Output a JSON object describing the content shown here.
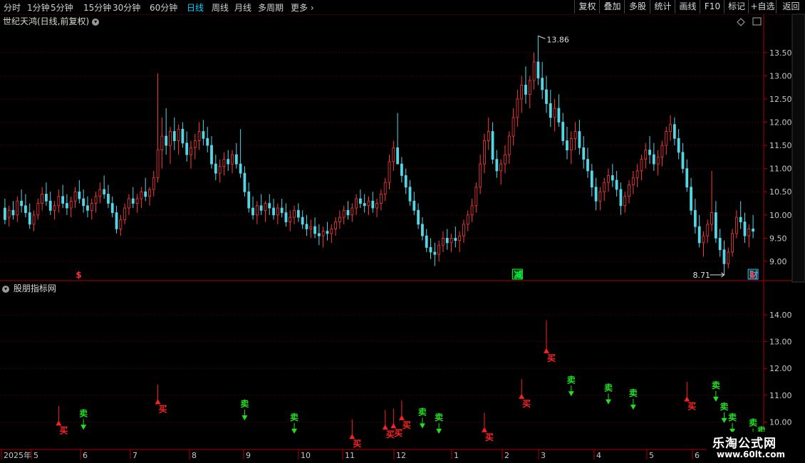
{
  "toolbar": {
    "periods": [
      "分时",
      "1分钟",
      "5分钟",
      "15分钟",
      "30分钟",
      "60分钟",
      "日线",
      "周线",
      "月线",
      "多周期",
      "更多"
    ],
    "selected": "日线",
    "right_buttons": [
      "复权",
      "叠加",
      "多股",
      "统计",
      "画线",
      "F10",
      "标记",
      "+自选",
      "返回"
    ]
  },
  "price_panel": {
    "title": "世纪天鸿(日线,前复权)",
    "high_label": "13.86",
    "low_label": "8.71",
    "y_ticks": [
      "13.50",
      "13.00",
      "12.50",
      "12.00",
      "11.50",
      "11.00",
      "10.50",
      "10.00",
      "9.50",
      "9.00"
    ],
    "markers": [
      {
        "text": "$",
        "color": "#ff3030"
      },
      {
        "text": "减",
        "color": "#00ff40"
      },
      {
        "text": "财",
        "color": "#4aa0ff"
      },
      {
        "text": "$",
        "color": "#ff3030"
      }
    ]
  },
  "indicator_panel": {
    "title": "股朋指标网",
    "y_ticks": [
      "14.00",
      "13.00",
      "12.00",
      "11.00",
      "10.00"
    ],
    "buy_label": "买",
    "sell_label": "卖"
  },
  "date_axis": {
    "labels": [
      "2025年",
      "5",
      "6",
      "7",
      "8",
      "9",
      "10",
      "11",
      "12",
      "1",
      "2",
      "3",
      "4",
      "5",
      "6"
    ]
  },
  "watermark": {
    "line1": "乐淘公式网",
    "line2": "www.60lt.com"
  },
  "colors": {
    "up": "#ff3a3a",
    "down": "#54d6e6",
    "buy": "#ff2020",
    "sell": "#20e020",
    "grid": "#6a0000"
  },
  "chart_data": {
    "type": "candlestick",
    "ylim_price": [
      8.6,
      14.05
    ],
    "ylim_indicator": [
      9.0,
      14.8
    ],
    "series_desc": "daily OHLC, approx",
    "candles": [
      [
        10.15,
        10.35,
        9.8,
        9.9
      ],
      [
        9.95,
        10.2,
        9.75,
        10.1
      ],
      [
        10.1,
        10.3,
        9.9,
        10.0
      ],
      [
        10.0,
        10.4,
        9.85,
        10.3
      ],
      [
        10.3,
        10.55,
        10.05,
        10.2
      ],
      [
        10.2,
        10.45,
        9.95,
        10.05
      ],
      [
        10.05,
        10.25,
        9.7,
        9.8
      ],
      [
        9.8,
        10.1,
        9.65,
        10.0
      ],
      [
        10.0,
        10.35,
        9.9,
        10.25
      ],
      [
        10.25,
        10.6,
        10.1,
        10.45
      ],
      [
        10.45,
        10.7,
        10.2,
        10.3
      ],
      [
        10.3,
        10.5,
        10.0,
        10.1
      ],
      [
        10.1,
        10.3,
        9.9,
        10.2
      ],
      [
        10.2,
        10.55,
        10.05,
        10.4
      ],
      [
        10.4,
        10.65,
        10.15,
        10.25
      ],
      [
        10.25,
        10.45,
        10.0,
        10.15
      ],
      [
        10.15,
        10.4,
        9.95,
        10.3
      ],
      [
        10.3,
        10.6,
        10.15,
        10.5
      ],
      [
        10.5,
        10.75,
        10.25,
        10.35
      ],
      [
        10.35,
        10.55,
        10.05,
        10.2
      ],
      [
        10.2,
        10.4,
        9.95,
        10.1
      ],
      [
        10.1,
        10.35,
        9.9,
        10.25
      ],
      [
        10.25,
        10.5,
        10.05,
        10.4
      ],
      [
        10.4,
        10.7,
        10.25,
        10.55
      ],
      [
        10.55,
        10.85,
        10.35,
        10.45
      ],
      [
        10.45,
        10.65,
        10.15,
        10.25
      ],
      [
        10.25,
        10.4,
        9.95,
        10.05
      ],
      [
        10.05,
        10.2,
        9.6,
        9.7
      ],
      [
        9.7,
        10.0,
        9.55,
        9.9
      ],
      [
        9.9,
        10.25,
        9.8,
        10.15
      ],
      [
        10.15,
        10.45,
        10.0,
        10.35
      ],
      [
        10.35,
        10.6,
        10.15,
        10.25
      ],
      [
        10.25,
        10.45,
        10.05,
        10.35
      ],
      [
        10.35,
        10.6,
        10.15,
        10.5
      ],
      [
        10.5,
        10.8,
        10.3,
        10.4
      ],
      [
        10.4,
        10.6,
        10.2,
        10.55
      ],
      [
        10.55,
        10.95,
        10.4,
        10.8
      ],
      [
        10.8,
        13.05,
        10.7,
        11.4
      ],
      [
        11.4,
        12.1,
        11.0,
        11.7
      ],
      [
        11.7,
        12.3,
        11.3,
        11.5
      ],
      [
        11.5,
        11.9,
        11.1,
        11.8
      ],
      [
        11.8,
        12.1,
        11.4,
        11.6
      ],
      [
        11.6,
        11.95,
        11.3,
        11.85
      ],
      [
        11.85,
        12.0,
        11.45,
        11.55
      ],
      [
        11.55,
        11.8,
        11.15,
        11.3
      ],
      [
        11.3,
        11.6,
        11.0,
        11.45
      ],
      [
        11.45,
        11.75,
        11.2,
        11.6
      ],
      [
        11.6,
        12.0,
        11.4,
        11.8
      ],
      [
        11.8,
        12.05,
        11.5,
        11.65
      ],
      [
        11.65,
        11.9,
        11.35,
        11.5
      ],
      [
        11.5,
        11.7,
        11.0,
        11.1
      ],
      [
        11.1,
        11.3,
        10.75,
        10.9
      ],
      [
        10.9,
        11.2,
        10.7,
        11.05
      ],
      [
        11.05,
        11.35,
        10.85,
        11.2
      ],
      [
        11.2,
        11.4,
        10.95,
        11.1
      ],
      [
        11.1,
        11.4,
        10.9,
        11.3
      ],
      [
        11.3,
        11.55,
        11.0,
        11.1
      ],
      [
        11.1,
        11.85,
        10.8,
        10.9
      ],
      [
        10.9,
        11.05,
        10.4,
        10.5
      ],
      [
        10.5,
        10.7,
        10.05,
        10.15
      ],
      [
        10.15,
        10.4,
        9.9,
        10.0
      ],
      [
        10.0,
        10.3,
        9.8,
        10.2
      ],
      [
        10.2,
        10.45,
        10.0,
        10.1
      ],
      [
        10.1,
        10.3,
        9.85,
        10.25
      ],
      [
        10.25,
        10.45,
        10.0,
        10.15
      ],
      [
        10.15,
        10.35,
        9.9,
        10.0
      ],
      [
        10.0,
        10.25,
        9.8,
        10.15
      ],
      [
        10.15,
        10.35,
        9.95,
        10.05
      ],
      [
        10.05,
        10.25,
        9.75,
        9.85
      ],
      [
        9.85,
        10.1,
        9.65,
        9.95
      ],
      [
        9.95,
        10.2,
        9.8,
        10.1
      ],
      [
        10.1,
        10.25,
        9.85,
        9.95
      ],
      [
        9.95,
        10.1,
        9.7,
        9.8
      ],
      [
        9.8,
        10.0,
        9.55,
        9.7
      ],
      [
        9.7,
        9.9,
        9.5,
        9.75
      ],
      [
        9.75,
        9.95,
        9.5,
        9.6
      ],
      [
        9.6,
        9.8,
        9.35,
        9.55
      ],
      [
        9.55,
        9.75,
        9.3,
        9.65
      ],
      [
        9.65,
        9.85,
        9.45,
        9.6
      ],
      [
        9.6,
        9.8,
        9.4,
        9.7
      ],
      [
        9.7,
        9.95,
        9.55,
        9.85
      ],
      [
        9.85,
        10.1,
        9.7,
        9.95
      ],
      [
        9.95,
        10.2,
        9.8,
        10.1
      ],
      [
        10.1,
        10.3,
        9.9,
        10.0
      ],
      [
        10.0,
        10.25,
        9.85,
        10.15
      ],
      [
        10.15,
        10.45,
        10.0,
        10.35
      ],
      [
        10.35,
        10.55,
        10.15,
        10.25
      ],
      [
        10.25,
        10.45,
        10.05,
        10.2
      ],
      [
        10.2,
        10.4,
        10.0,
        10.3
      ],
      [
        10.3,
        10.5,
        10.05,
        10.15
      ],
      [
        10.15,
        10.35,
        9.95,
        10.25
      ],
      [
        10.25,
        10.55,
        10.1,
        10.45
      ],
      [
        10.45,
        10.8,
        10.3,
        10.7
      ],
      [
        10.7,
        11.3,
        10.55,
        11.15
      ],
      [
        11.15,
        11.6,
        10.95,
        11.45
      ],
      [
        11.45,
        12.2,
        11.25,
        11.1
      ],
      [
        11.1,
        11.25,
        10.7,
        10.85
      ],
      [
        10.85,
        11.0,
        10.45,
        10.6
      ],
      [
        10.6,
        10.75,
        10.2,
        10.3
      ],
      [
        10.3,
        10.5,
        10.0,
        10.1
      ],
      [
        10.1,
        10.25,
        9.7,
        9.8
      ],
      [
        9.8,
        9.95,
        9.45,
        9.55
      ],
      [
        9.55,
        9.7,
        9.2,
        9.3
      ],
      [
        9.3,
        9.5,
        9.05,
        9.2
      ],
      [
        9.2,
        9.4,
        8.9,
        9.15
      ],
      [
        9.15,
        9.45,
        9.0,
        9.35
      ],
      [
        9.35,
        9.65,
        9.2,
        9.5
      ],
      [
        9.5,
        9.7,
        9.25,
        9.4
      ],
      [
        9.4,
        9.6,
        9.2,
        9.5
      ],
      [
        9.5,
        9.75,
        9.3,
        9.45
      ],
      [
        9.45,
        9.65,
        9.2,
        9.55
      ],
      [
        9.55,
        9.9,
        9.4,
        9.8
      ],
      [
        9.8,
        10.1,
        9.65,
        10.0
      ],
      [
        10.0,
        10.35,
        9.85,
        10.2
      ],
      [
        10.2,
        10.7,
        10.05,
        10.6
      ],
      [
        10.6,
        11.3,
        10.45,
        11.1
      ],
      [
        11.1,
        11.75,
        10.9,
        11.6
      ],
      [
        11.6,
        12.1,
        11.4,
        11.8
      ],
      [
        11.8,
        12.0,
        11.1,
        11.2
      ],
      [
        11.2,
        11.4,
        10.8,
        10.95
      ],
      [
        10.95,
        11.2,
        10.65,
        11.1
      ],
      [
        11.1,
        11.5,
        10.9,
        11.3
      ],
      [
        11.3,
        11.8,
        11.1,
        11.7
      ],
      [
        11.7,
        12.3,
        11.5,
        12.1
      ],
      [
        12.1,
        12.7,
        11.9,
        12.5
      ],
      [
        12.5,
        13.0,
        12.2,
        12.8
      ],
      [
        12.8,
        13.2,
        12.4,
        12.6
      ],
      [
        12.6,
        13.0,
        12.3,
        12.9
      ],
      [
        12.9,
        13.5,
        12.7,
        13.3
      ],
      [
        13.3,
        13.86,
        12.8,
        12.95
      ],
      [
        12.95,
        13.3,
        12.5,
        12.7
      ],
      [
        12.7,
        13.0,
        12.2,
        12.4
      ],
      [
        12.4,
        12.7,
        11.9,
        12.1
      ],
      [
        12.1,
        12.5,
        11.8,
        12.3
      ],
      [
        12.3,
        12.6,
        11.9,
        12.0
      ],
      [
        12.0,
        12.2,
        11.5,
        11.6
      ],
      [
        11.6,
        11.9,
        11.2,
        11.4
      ],
      [
        11.4,
        11.8,
        11.1,
        11.65
      ],
      [
        11.65,
        12.0,
        11.4,
        11.8
      ],
      [
        11.8,
        12.05,
        11.3,
        11.45
      ],
      [
        11.45,
        11.7,
        11.0,
        11.2
      ],
      [
        11.2,
        11.45,
        10.8,
        10.95
      ],
      [
        10.95,
        11.1,
        10.4,
        10.6
      ],
      [
        10.6,
        10.8,
        10.1,
        10.3
      ],
      [
        10.3,
        10.6,
        10.1,
        10.5
      ],
      [
        10.5,
        10.8,
        10.3,
        10.7
      ],
      [
        10.7,
        11.0,
        10.5,
        10.85
      ],
      [
        10.85,
        11.1,
        10.6,
        10.75
      ],
      [
        10.75,
        10.95,
        10.4,
        10.55
      ],
      [
        10.55,
        10.7,
        10.0,
        10.2
      ],
      [
        10.2,
        10.5,
        10.05,
        10.4
      ],
      [
        10.4,
        10.75,
        10.25,
        10.65
      ],
      [
        10.65,
        10.95,
        10.45,
        10.8
      ],
      [
        10.8,
        11.1,
        10.6,
        10.95
      ],
      [
        10.95,
        11.3,
        10.75,
        11.2
      ],
      [
        11.2,
        11.55,
        11.0,
        11.4
      ],
      [
        11.4,
        11.7,
        11.1,
        11.3
      ],
      [
        11.3,
        11.55,
        10.95,
        11.1
      ],
      [
        11.1,
        11.4,
        10.85,
        11.25
      ],
      [
        11.25,
        11.6,
        11.05,
        11.5
      ],
      [
        11.5,
        11.9,
        11.3,
        11.8
      ],
      [
        11.8,
        12.15,
        11.6,
        11.95
      ],
      [
        11.95,
        12.1,
        11.5,
        11.65
      ],
      [
        11.65,
        11.85,
        11.2,
        11.35
      ],
      [
        11.35,
        11.55,
        10.9,
        11.0
      ],
      [
        11.0,
        11.2,
        10.5,
        10.6
      ],
      [
        10.6,
        10.8,
        10.0,
        10.1
      ],
      [
        10.1,
        10.35,
        9.6,
        9.75
      ],
      [
        9.75,
        10.0,
        9.3,
        9.4
      ],
      [
        9.4,
        9.65,
        9.1,
        9.55
      ],
      [
        9.55,
        9.9,
        9.4,
        9.8
      ],
      [
        9.8,
        10.95,
        9.65,
        10.05
      ],
      [
        10.05,
        10.3,
        9.4,
        9.5
      ],
      [
        9.5,
        9.7,
        9.1,
        9.25
      ],
      [
        9.25,
        9.45,
        8.71,
        8.95
      ],
      [
        8.95,
        9.3,
        8.85,
        9.2
      ],
      [
        9.2,
        9.7,
        9.1,
        9.6
      ],
      [
        9.6,
        10.1,
        9.5,
        9.95
      ],
      [
        9.95,
        10.3,
        9.7,
        9.85
      ],
      [
        9.85,
        10.05,
        9.4,
        9.55
      ],
      [
        9.55,
        9.8,
        9.3,
        9.7
      ],
      [
        9.7,
        10.0,
        9.5,
        9.65
      ]
    ],
    "signals": [
      {
        "type": "buy",
        "i": 13,
        "price": 10.0
      },
      {
        "type": "sell",
        "i": 19,
        "price": 9.95
      },
      {
        "type": "buy",
        "i": 37,
        "price": 10.8
      },
      {
        "type": "sell",
        "i": 58,
        "price": 10.3
      },
      {
        "type": "sell",
        "i": 70,
        "price": 9.8
      },
      {
        "type": "buy",
        "i": 84,
        "price": 9.5
      },
      {
        "type": "buy",
        "i": 92,
        "price": 9.85
      },
      {
        "type": "buy",
        "i": 94,
        "price": 9.9
      },
      {
        "type": "buy",
        "i": 96,
        "price": 10.2
      },
      {
        "type": "sell",
        "i": 101,
        "price": 10.0
      },
      {
        "type": "sell",
        "i": 105,
        "price": 9.8
      },
      {
        "type": "buy",
        "i": 116,
        "price": 9.75
      },
      {
        "type": "buy",
        "i": 125,
        "price": 11.0
      },
      {
        "type": "buy",
        "i": 131,
        "price": 12.7
      },
      {
        "type": "sell",
        "i": 137,
        "price": 11.2
      },
      {
        "type": "sell",
        "i": 146,
        "price": 10.9
      },
      {
        "type": "sell",
        "i": 152,
        "price": 10.7
      },
      {
        "type": "buy",
        "i": 165,
        "price": 10.9
      },
      {
        "type": "sell",
        "i": 172,
        "price": 11.0
      },
      {
        "type": "sell",
        "i": 174,
        "price": 10.2
      },
      {
        "type": "sell",
        "i": 176,
        "price": 9.8
      },
      {
        "type": "sell",
        "i": 181,
        "price": 9.6
      },
      {
        "type": "sell",
        "i": 183,
        "price": 9.3
      }
    ]
  }
}
